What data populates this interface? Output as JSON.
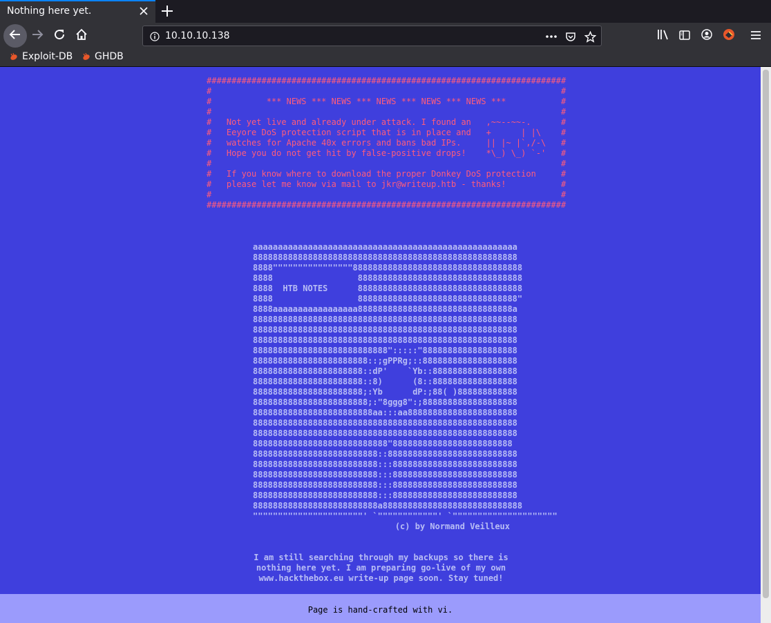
{
  "browser": {
    "tab_title": "Nothing here yet.",
    "url": "10.10.10.138",
    "bookmarks": [
      {
        "label": "Exploit-DB"
      },
      {
        "label": "GHDB"
      }
    ],
    "icons": [
      "close-icon",
      "plus-icon",
      "back-arrow-icon",
      "forward-arrow-icon",
      "reload-icon",
      "home-icon",
      "info-icon",
      "more-icon",
      "pocket-icon",
      "star-icon",
      "library-icon",
      "sidebar-icon",
      "account-icon",
      "extension-icon",
      "menu-icon"
    ]
  },
  "page": {
    "background_color": "#3f3fdd",
    "news_color": "#ff5c7c",
    "news_block": "########################################################################\n#                                                                      #\n#           *** NEWS *** NEWS *** NEWS *** NEWS *** NEWS ***           #\n#                                                                      #\n#   Not yet live and already under attack. I found an   ,~~--~~-.      #\n#   Eeyore DoS protection script that is in place and   +      | |\\    #\n#   watches for Apache 40x errors and bans bad IPs.     || |~ |`,/-\\   #\n#   Hope you do not get hit by false-positive drops!    *\\_) \\_) `-'   #\n#                                                                      #\n#   If you know where to download the proper Donkey DoS protection     #\n#   please let me know via mail to jkr@writeup.htb - thanks!           #\n#                                                                      #\n########################################################################",
    "ascii_art": "aaaaaaaaaaaaaaaaaaaaaaaaaaaaaaaaaaaaaaaaaaaaaaaaaaaaa\n88888888888888888888888888888888888888888888888888888\n8888\"\"\"\"\"\"\"\"\"\"\"\"\"\"\"\"8888888888888888888888888888888888\n8888                 888888888888888888888888888888888\n8888  HTB NOTES      888888888888888888888888888888888\n8888                 88888888888888888888888888888888\"\n8888aaaaaaaaaaaaaaaaa8888888888888888888888888888888a\n88888888888888888888888888888888888888888888888888888\n88888888888888888888888888888888888888888888888888888\n88888888888888888888888888888888888888888888888888888\n888888888888888888888888888\":::::\"8888888888888888888\n88888888888888888888888::;gPPRg;::8888888888888888888\n8888888888888888888888::dP'    `Yb::88888888888888888\n8888888888888888888888::8)      (8::88888888888888888\n8888888888888888888888;:Yb      dP:;88( )888888888888\n88888888888888888888888;:\"8ggg8\":;8888888888888888888\n888888888888888888888888aa:::aa8888888888888888888888\n88888888888888888888888888888888888888888888888888888\n88888888888888888888888888888888888888888888888888888\n888888888888888888888888888\"888888888888888888888888\n8888888888888888888888888::88888888888888888888888888\n8888888888888888888888888:::8888888888888888888888888\n8888888888888888888888888:::8888888888888888888888888\n8888888888888888888888888:::8888888888888888888888888\n8888888888888888888888888:::8888888888888888888888888\n8888888888888888888888888a8888888888888888888888888888\n\"\"\"\"\"\"\"\"\"\"\"\"\"\"\"\"\"\"\"\"\"\"' `\"\"\"\"\"\"\"\"\"\"\"\"' `\"\"\"\"\"\"\"\"\"\"\"\"\"\"\"\"\"\"\"\"\"",
    "credit": "(c) by Normand Veilleux",
    "message": "I am still searching through my backups so there is\nnothing here yet. I am preparing go-live of my own\nwww.hackthebox.eu write-up page soon. Stay tuned!",
    "footer": "Page is hand-crafted with vi."
  }
}
